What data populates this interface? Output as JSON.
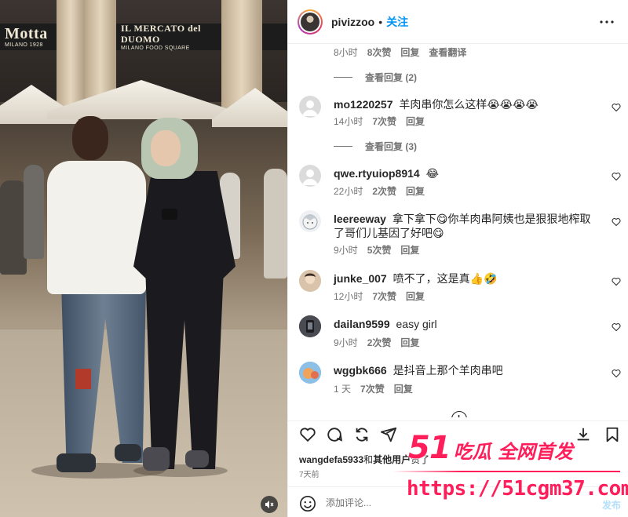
{
  "photo": {
    "storefront_sign_left": "Motta",
    "storefront_sign_left_sub": "MILANO 1928",
    "storefront_sign_right": "IL MERCATO del DUOMO",
    "storefront_sign_right_sub": "MILANO FOOD SQUARE"
  },
  "header": {
    "username": "pivizzoo",
    "separator": "•",
    "follow_label": "关注"
  },
  "top_comment_meta": {
    "time": "8小时",
    "likes": "8次赞",
    "reply": "回复",
    "translate": "查看翻译"
  },
  "view_replies_1": "查看回复 (2)",
  "view_replies_2": "查看回复 (3)",
  "comments": [
    {
      "username": "mo1220257",
      "text": "羊肉串你怎么这样😭😭😭😭",
      "time": "14小时",
      "likes": "7次赞",
      "reply": "回复"
    },
    {
      "username": "qwe.rtyuiop8914",
      "text": "😂",
      "time": "22小时",
      "likes": "2次赞",
      "reply": "回复"
    },
    {
      "username": "leereeway",
      "text": "拿下拿下😋你羊肉串阿姨也是狠狠地榨取了哥们儿基因了好吧😋",
      "time": "9小时",
      "likes": "5次赞",
      "reply": "回复"
    },
    {
      "username": "junke_007",
      "text": "喷不了，这是真👍🤣",
      "time": "12小时",
      "likes": "7次赞",
      "reply": "回复"
    },
    {
      "username": "dailan9599",
      "text": "easy girl",
      "time": "9小时",
      "likes": "2次赞",
      "reply": "回复"
    },
    {
      "username": "wggbk666",
      "text": "是抖音上那个羊肉串吧",
      "time": "1 天",
      "likes": "7次赞",
      "reply": "回复"
    }
  ],
  "likes_line": {
    "user": "wangdefa5933",
    "connector": "和",
    "others": "其他用户",
    "suffix": "赞了"
  },
  "post_time": "7天前",
  "add_comment": {
    "placeholder": "添加评论...",
    "post_label": "发布"
  },
  "watermark": {
    "num": "51",
    "title": "吃瓜 全网首发",
    "url": "https://51cgm37.com"
  },
  "colors": {
    "accent": "#0095f6",
    "watermark": "#ff1e5a",
    "muted": "#737373"
  }
}
